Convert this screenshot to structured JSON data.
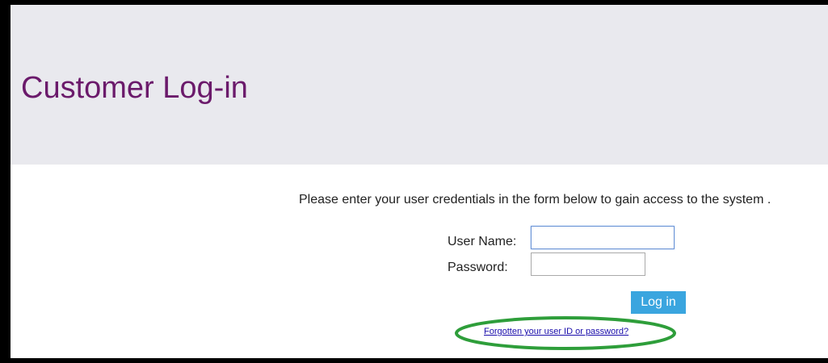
{
  "header": {
    "title": "Customer Log-in"
  },
  "main": {
    "instructions": "Please enter your user credentials in the form below to gain access to the system ."
  },
  "form": {
    "username_label": "User Name:",
    "username_value": "",
    "password_label": "Password:",
    "password_value": "",
    "login_label": "Log in",
    "forgot_link": "Forgotten your user ID or password?"
  },
  "colors": {
    "title": "#6b1a6b",
    "header_background": "#e9e9ee",
    "button": "#3aa5df",
    "highlight": "#2e9e3a",
    "frame": "#000000"
  }
}
